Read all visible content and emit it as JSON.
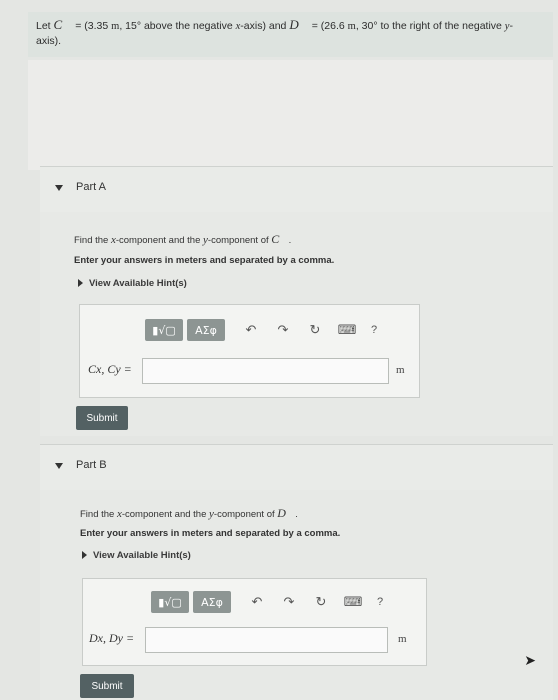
{
  "problem": {
    "let": "Let",
    "vec_c": "C",
    "c_def": "= (3.35",
    "m1": "m",
    "c_dir": ", 15° above the negative",
    "x1": "x",
    "c_end": "-axis) and",
    "vec_d": "D",
    "d_def": "= (26.6",
    "m2": "m",
    "d_dir": ", 30° to the right of the negative",
    "y1": "y",
    "axis_end": "-",
    "line2": "axis)."
  },
  "partA": {
    "title": "Part A",
    "q_pre": "Find the",
    "q_x": "x",
    "q_mid": "-component and the",
    "q_y": "y",
    "q_post": "-component of",
    "q_vec": "C",
    "q_dot": ".",
    "instruction": "Enter your answers in meters and separated by a comma.",
    "hint": "View Available Hint(s)",
    "var": "Cx, Cy =",
    "unit": "m",
    "submit": "Submit"
  },
  "partB": {
    "title": "Part B",
    "q_pre": "Find the",
    "q_x": "x",
    "q_mid": "-component and the",
    "q_y": "y",
    "q_post": "-component of",
    "q_vec": "D",
    "q_dot": ".",
    "instruction": "Enter your answers in meters and separated by a comma.",
    "hint": "View Available Hint(s)",
    "var": "Dx, Dy =",
    "unit": "m",
    "submit": "Submit"
  },
  "toolbar": {
    "templates": "▮√▢",
    "greek": "ΑΣφ",
    "help": "?"
  },
  "icons": [
    "undo-icon",
    "redo-icon",
    "reset-icon",
    "keyboard-icon"
  ]
}
